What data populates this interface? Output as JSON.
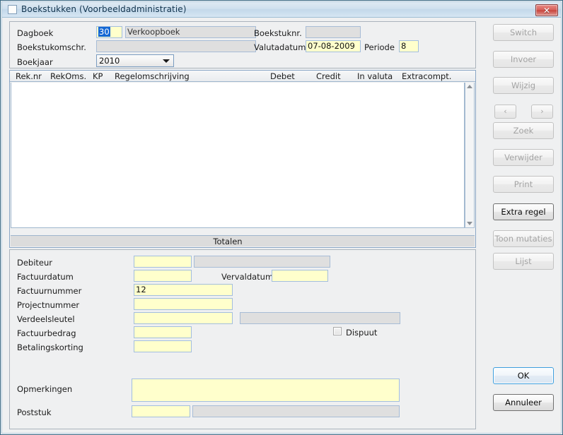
{
  "window": {
    "title": "Boekstukken (Voorbeeldadministratie)",
    "close_label": "✕",
    "icon": "window-icon"
  },
  "header": {
    "fields": [
      {
        "label": "Dagboek",
        "value": "30",
        "selected": true,
        "readonly": false
      },
      {
        "label": "Boekstukomschr.",
        "value": "",
        "selected": false,
        "readonly": true
      },
      {
        "label": "Boekjaar",
        "value": "2010",
        "selected": false,
        "readonly": false
      }
    ],
    "dagboek_label": "Dagboek",
    "dagboek_value": "30",
    "dagboek_name": "Verkoopboek",
    "boekstukomschr_label": "Boekstukomschr.",
    "boekstukomschr_value": "",
    "boekjaar_label": "Boekjaar",
    "boekjaar_value": "2010",
    "boekstuknr_label": "Boekstuknr.",
    "boekstuknr_value": "",
    "valutadatum_label": "Valutadatum",
    "valutadatum_value": "07-08-2009",
    "periode_label": "Periode",
    "periode_value": "8"
  },
  "grid": {
    "columns": [
      "Rek.nr",
      "RekOms.",
      "KP",
      "Regelomschrijving",
      "Debet",
      "Credit",
      "In valuta",
      "Extracompt."
    ],
    "rows": [],
    "totals_label": "Totalen",
    "scroll_up": "scroll-up-arrow",
    "scroll_down": "scroll-down-arrow"
  },
  "detail": {
    "debiteur_label": "Debiteur",
    "debiteur_value": "",
    "debiteur_name_value": "",
    "factuurdatum_label": "Factuurdatum",
    "factuurdatum_value": "",
    "vervaldatum_label": "Vervaldatum",
    "vervaldatum_value": "",
    "factuurnummer_label": "Factuurnummer",
    "factuurnummer_value": "12",
    "projectnummer_label": "Projectnummer",
    "projectnummer_value": "",
    "verdeelsleutel_label": "Verdeelsleutel",
    "verdeelsleutel_value": "",
    "verdeelsleutel_desc_value": "",
    "factuurbedrag_label": "Factuurbedrag",
    "factuurbedrag_value": "",
    "betalingskorting_label": "Betalingskorting",
    "betalingskorting_value": "",
    "dispuut_label": "Dispuut",
    "dispuut_checked": false,
    "opmerkingen_label": "Opmerkingen",
    "opmerkingen_value": "",
    "poststuk_label": "Poststuk",
    "poststuk_value": "",
    "poststuk_desc_value": ""
  },
  "sidebar": {
    "buttons": [
      {
        "label": "Switch",
        "enabled": false
      },
      {
        "label": "Invoer",
        "enabled": false
      },
      {
        "label": "Wijzig",
        "enabled": false
      },
      {
        "label": "‹",
        "enabled": false
      },
      {
        "label": "›",
        "enabled": false
      },
      {
        "label": "Zoek",
        "enabled": false
      },
      {
        "label": "Verwijder",
        "enabled": false
      },
      {
        "label": "Print",
        "enabled": false
      },
      {
        "label": "Extra regel",
        "enabled": true
      },
      {
        "label": "Toon mutaties",
        "enabled": false
      },
      {
        "label": "Lijst",
        "enabled": false
      }
    ],
    "switch_label": "Switch",
    "invoer_label": "Invoer",
    "wijzig_label": "Wijzig",
    "prev_label": "‹",
    "next_label": "›",
    "zoek_label": "Zoek",
    "verwijder_label": "Verwijder",
    "print_label": "Print",
    "extra_regel_label": "Extra regel",
    "toon_mutaties_label": "Toon mutaties",
    "lijst_label": "Lijst",
    "ok_label": "OK",
    "annuleer_label": "Annuleer"
  },
  "colors": {
    "input_yellow": "#ffffcc",
    "input_readonly": "#dfdfdf",
    "input_border": "#a3bede",
    "selection_blue": "#1367d4",
    "panel_bg": "#eff0f1",
    "default_button_border": "#3c9ede",
    "close_button_red": "#c8453e"
  }
}
